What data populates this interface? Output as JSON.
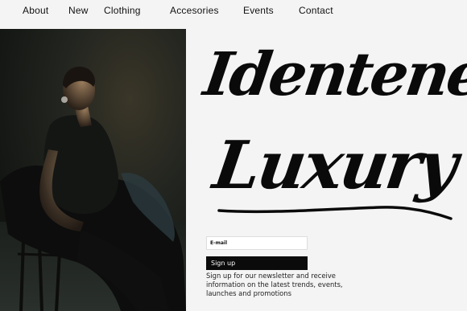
{
  "nav": {
    "items": [
      {
        "label": "About"
      },
      {
        "label": "New"
      },
      {
        "label": "Clothing"
      },
      {
        "label": "Accesories"
      },
      {
        "label": "Events"
      },
      {
        "label": "Contact"
      }
    ]
  },
  "hero": {
    "title_line1": "Identene",
    "title_line2": "Luxury"
  },
  "newsletter": {
    "email_placeholder": "E-mail",
    "signup_label": "Sign up",
    "description": "Sign up for our newsletter and receive information on the latest trends, events, launches and promotions"
  }
}
